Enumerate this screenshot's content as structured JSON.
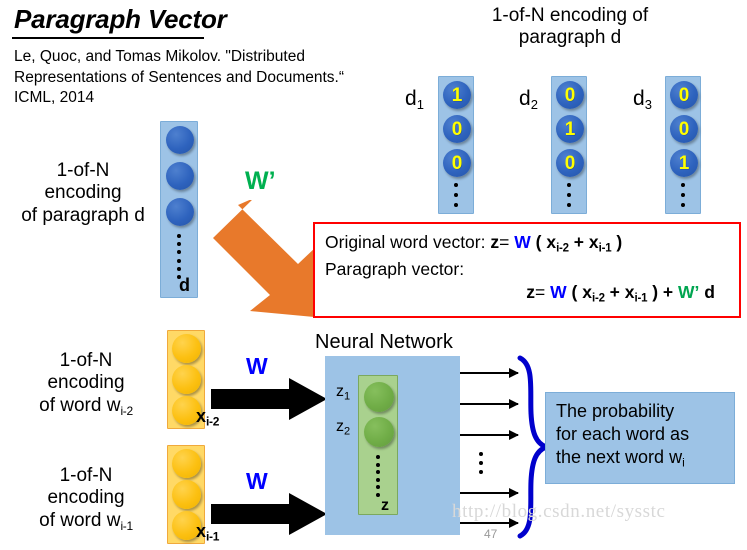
{
  "slide": {
    "title": "Paragraph Vector",
    "citation": "Le, Quoc, and Tomas Mikolov. \"Distributed Representations of Sentences and Documents.“ ICML, 2014",
    "page_number": "47",
    "watermark": "http://blog.csdn.net/sysstc"
  },
  "colors": {
    "node_blue": "#2e63be",
    "node_yellow": "#fcc011",
    "node_green": "#70ad47",
    "panel_blue": "#9dc3e6",
    "panel_yellow": "#ffd966",
    "panel_green": "#a9d18e",
    "arrow_orange": "#e8792b",
    "formula_border": "#ff0000",
    "w_color": "#0000ff",
    "w_prime_color": "#00b050",
    "digit_color": "#ffff00",
    "brace_blue": "#0000cc"
  },
  "top_encoding": {
    "heading_line1": "1-of-N encoding of",
    "heading_line2": "paragraph d",
    "vectors": [
      {
        "label": "d",
        "label_sub": "1",
        "values": [
          "1",
          "0",
          "0"
        ]
      },
      {
        "label": "d",
        "label_sub": "2",
        "values": [
          "0",
          "1",
          "0"
        ]
      },
      {
        "label": "d",
        "label_sub": "3",
        "values": [
          "0",
          "0",
          "1"
        ]
      }
    ]
  },
  "paragraph_input": {
    "caption_line1": "1-of-N",
    "caption_line2": "encoding",
    "caption_line3": "of paragraph d",
    "vector_label": "d",
    "node_count": 3,
    "weight_label": "W’"
  },
  "word_inputs": [
    {
      "caption_line1": "1-of-N",
      "caption_line2": "encoding",
      "caption_line3_prefix": "of word w",
      "caption_line3_sub": "i-2",
      "vector_label": "x",
      "vector_label_sub": "i-2",
      "node_count": 3,
      "weight_label": "W"
    },
    {
      "caption_line1": "1-of-N",
      "caption_line2": "encoding",
      "caption_line3_prefix": "of word w",
      "caption_line3_sub": "i-1",
      "vector_label": "x",
      "vector_label_sub": "i-1",
      "node_count": 3,
      "weight_label": "W"
    }
  ],
  "formula": {
    "line1_label": "Original word vector:",
    "line1_lhs": "z",
    "line1_eq": "=",
    "line1_w": "W",
    "line1_open": "(",
    "line1_x1": "x",
    "line1_x1_sub": "i-2",
    "line1_plus": "+",
    "line1_x2": "x",
    "line1_x2_sub": "i-1",
    "line1_close": ")",
    "line2_label": "Paragraph vector:",
    "line2_lhs": "z",
    "line2_eq": "=",
    "line2_w": "W",
    "line2_open": "(",
    "line2_x1": "x",
    "line2_x1_sub": "i-2",
    "line2_plus": "+",
    "line2_x2": "x",
    "line2_x2_sub": "i-1",
    "line2_close": ")",
    "line2_plus2": "+",
    "line2_wprime": "W’",
    "line2_d": "d"
  },
  "neural_network": {
    "label": "Neural Network",
    "hidden_label": "z",
    "hidden_nodes": [
      {
        "label": "z",
        "sub": "1"
      },
      {
        "label": "z",
        "sub": "2"
      }
    ],
    "output_arrow_count": 5
  },
  "probability_box": {
    "line1": "The probability",
    "line2": "for each word as",
    "line3_prefix": "the next word w",
    "line3_sub": "i"
  }
}
